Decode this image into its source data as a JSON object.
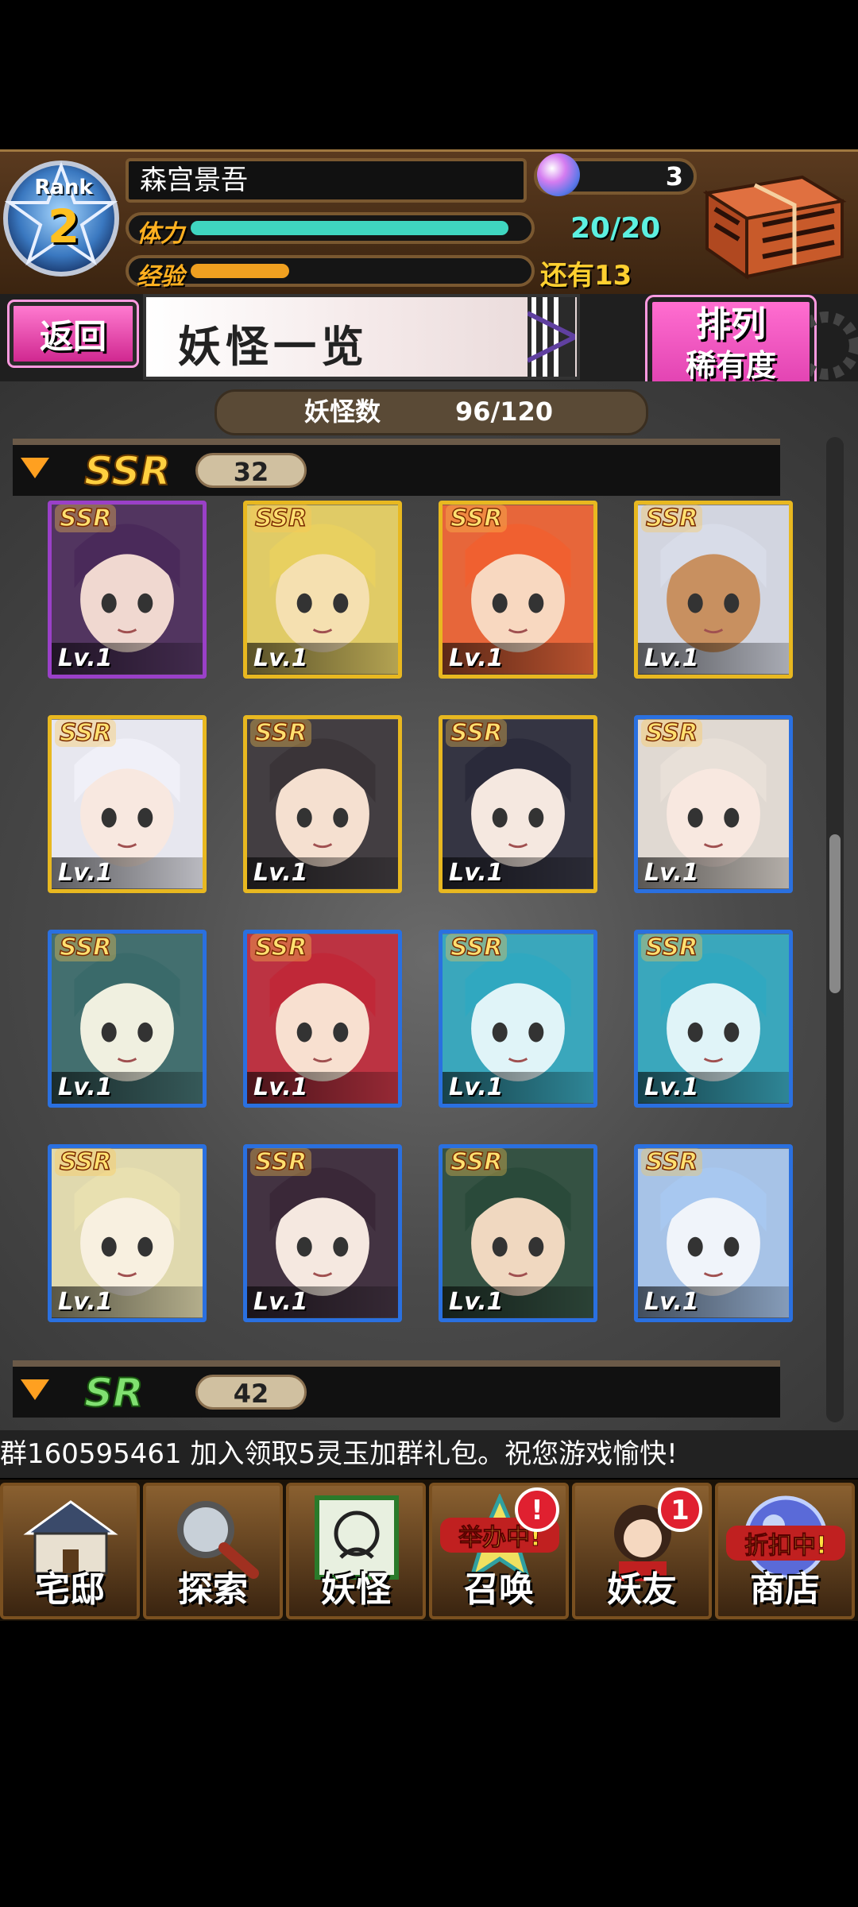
{
  "player": {
    "rank_label": "Rank",
    "rank": "2",
    "name": "森宫景吾",
    "gems": "3",
    "stamina_label": "体力",
    "stamina": "20/20",
    "stamina_fraction": 1.0,
    "exp_label": "经验",
    "exp_remaining": "还有13",
    "exp_fraction": 0.31
  },
  "header": {
    "back_label": "返回",
    "title": "妖怪一览",
    "sort_line1": "排列",
    "sort_line2": "稀有度"
  },
  "collection": {
    "count_label": "妖怪数",
    "count_value": "96/120"
  },
  "sections": [
    {
      "rarity": "SSR",
      "count": "32"
    },
    {
      "rarity": "SR",
      "count": "42"
    }
  ],
  "cards": [
    {
      "tag": "SSR",
      "level": "Lv.1"
    },
    {
      "tag": "SSR",
      "level": "Lv.1"
    },
    {
      "tag": "SSR",
      "level": "Lv.1"
    },
    {
      "tag": "SSR",
      "level": "Lv.1"
    },
    {
      "tag": "SSR",
      "level": "Lv.1"
    },
    {
      "tag": "SSR",
      "level": "Lv.1"
    },
    {
      "tag": "SSR",
      "level": "Lv.1"
    },
    {
      "tag": "SSR",
      "level": "Lv.1"
    },
    {
      "tag": "SSR",
      "level": "Lv.1"
    },
    {
      "tag": "SSR",
      "level": "Lv.1"
    },
    {
      "tag": "SSR",
      "level": "Lv.1"
    },
    {
      "tag": "SSR",
      "level": "Lv.1"
    },
    {
      "tag": "SSR",
      "level": "Lv.1"
    },
    {
      "tag": "SSR",
      "level": "Lv.1"
    },
    {
      "tag": "SSR",
      "level": "Lv.1"
    },
    {
      "tag": "SSR",
      "level": "Lv.1"
    }
  ],
  "ticker": "群160595461  加入领取5灵玉加群礼包。祝您游戏愉快!",
  "nav": [
    {
      "label": "宅邸"
    },
    {
      "label": "探索"
    },
    {
      "label": "妖怪"
    },
    {
      "label": "召唤",
      "banner": "举办中!",
      "badge": "!"
    },
    {
      "label": "妖友",
      "badge": "1"
    },
    {
      "label": "商店",
      "banner": "折扣中!"
    }
  ],
  "colors": {
    "accent_pink": "#e040b0",
    "stamina_bar": "#3fd6c0",
    "exp_bar": "#f0a020",
    "card_gold": "#e8b820",
    "card_blue": "#2a70e0",
    "card_purple": "#9a40c8"
  }
}
